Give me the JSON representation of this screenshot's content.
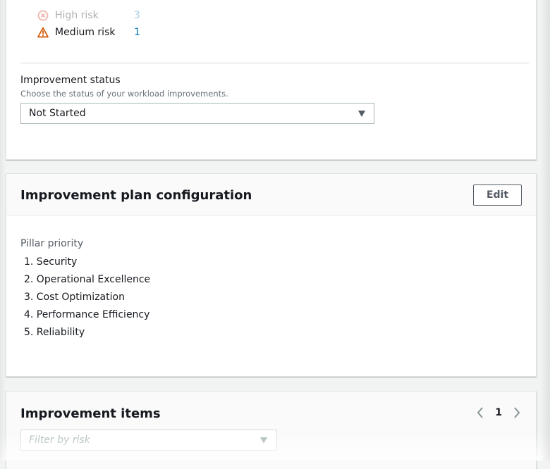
{
  "risk_summary": {
    "high": {
      "label": "High risk",
      "count": "3"
    },
    "medium": {
      "label": "Medium risk",
      "count": "1"
    }
  },
  "improvement_status": {
    "label": "Improvement status",
    "description": "Choose the status of your workload improvements.",
    "selected": "Not Started"
  },
  "improvement_plan": {
    "title": "Improvement plan configuration",
    "edit_label": "Edit",
    "pillar_priority_label": "Pillar priority",
    "pillars": [
      "1. Security",
      "2. Operational Excellence",
      "3. Cost Optimization",
      "4. Performance Efficiency",
      "5. Reliability"
    ]
  },
  "improvement_items": {
    "title": "Improvement items",
    "page": "1",
    "filter_placeholder": "Filter by risk"
  },
  "colors": {
    "link": "#0073bb",
    "high_risk": "#d13212",
    "medium_risk": "#d45b07",
    "background": "#f2f3f3"
  }
}
